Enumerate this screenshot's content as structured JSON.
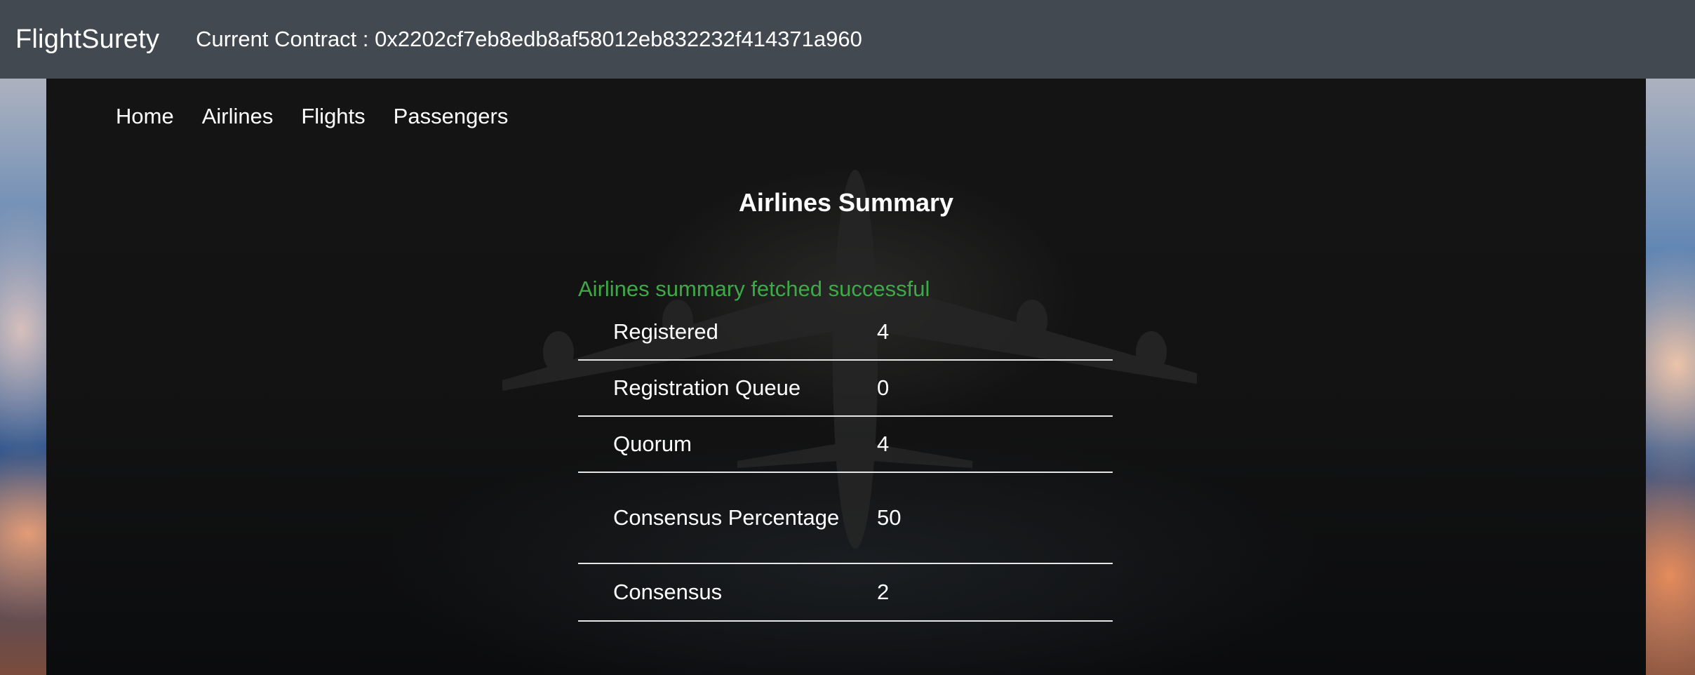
{
  "app": {
    "brand": "FlightSurety",
    "contract_label": "Current Contract : 0x2202cf7eb8edb8af58012eb832232f414371a960"
  },
  "nav": {
    "items": [
      {
        "label": "Home"
      },
      {
        "label": "Airlines"
      },
      {
        "label": "Flights"
      },
      {
        "label": "Passengers"
      }
    ]
  },
  "main": {
    "title": "Airlines Summary",
    "status_message": "Airlines summary fetched successful",
    "status_color": "#3dab45",
    "summary_rows": [
      {
        "label": "Registered",
        "value": "4"
      },
      {
        "label": "Registration Queue",
        "value": "0"
      },
      {
        "label": "Quorum",
        "value": "4"
      },
      {
        "label": "Consensus Percentage",
        "value": "50"
      },
      {
        "label": "Consensus",
        "value": "2"
      }
    ]
  },
  "colors": {
    "topbar": "#434951",
    "panel": "#131313",
    "text": "#ffffff"
  }
}
